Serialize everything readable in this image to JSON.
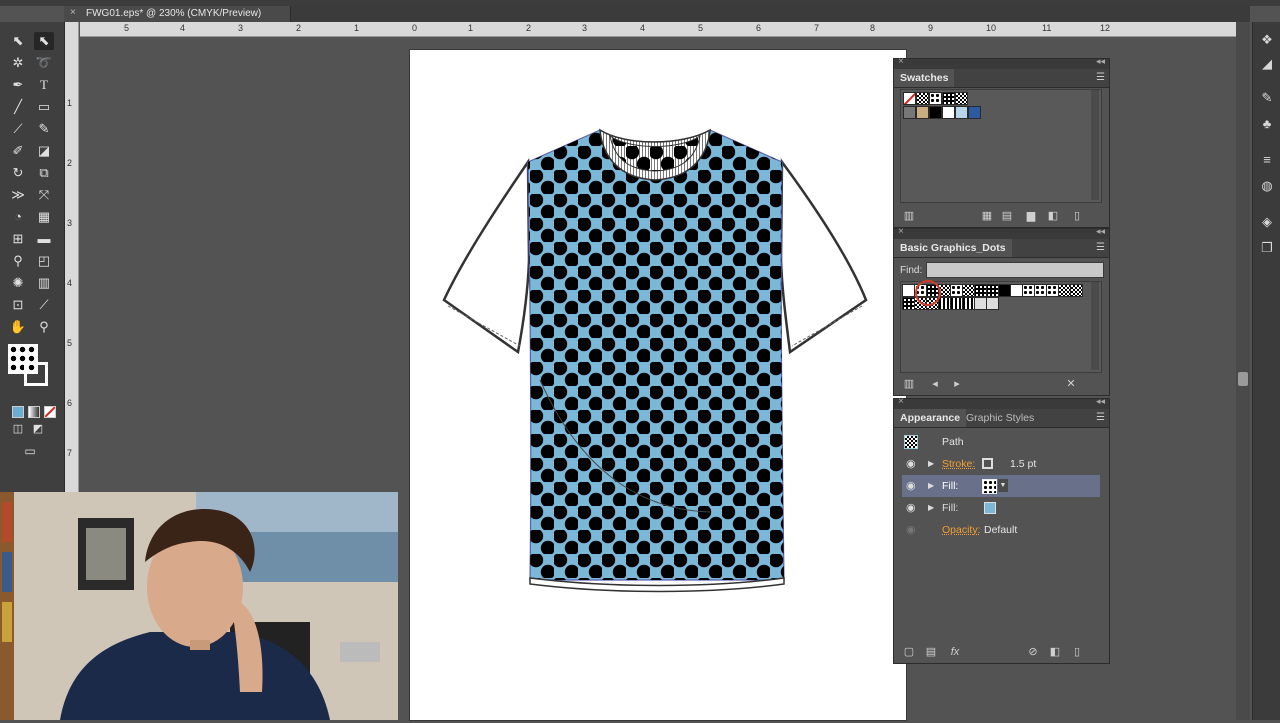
{
  "document": {
    "tab_title": "FWG01.eps* @ 230% (CMYK/Preview)",
    "close_glyph": "×"
  },
  "rulers": {
    "horizontal": [
      "5",
      "4",
      "3",
      "2",
      "1",
      "0",
      "1",
      "2",
      "3",
      "4",
      "5",
      "6",
      "7",
      "8",
      "9",
      "10",
      "11",
      "12"
    ],
    "vertical": [
      "1",
      "2",
      "3",
      "4",
      "5",
      "6",
      "7"
    ]
  },
  "tools": {
    "icons": [
      "selection-tool-icon",
      "direct-selection-tool-icon",
      "magic-wand-tool-icon",
      "lasso-tool-icon",
      "pen-tool-icon",
      "type-tool-icon",
      "line-tool-icon",
      "rectangle-tool-icon",
      "paintbrush-tool-icon",
      "pencil-tool-icon",
      "shaper-tool-icon",
      "eraser-tool-icon",
      "rotate-tool-icon",
      "scale-tool-icon",
      "width-tool-icon",
      "free-transform-tool-icon",
      "shape-builder-tool-icon",
      "perspective-grid-tool-icon",
      "mesh-tool-icon",
      "gradient-tool-icon",
      "eyedropper-tool-icon",
      "blend-tool-icon",
      "symbol-sprayer-tool-icon",
      "column-graph-tool-icon",
      "artboard-tool-icon",
      "slice-tool-icon",
      "hand-tool-icon",
      "zoom-tool-icon"
    ]
  },
  "swatches_panel": {
    "title": "Swatches",
    "colors": [
      "#ffffff",
      "#c8ad7f",
      "#000000",
      "#ffffff",
      "#b7d6e8",
      "#6aaed6",
      "#2b5aa0"
    ]
  },
  "library_panel": {
    "title": "Basic Graphics_Dots",
    "find_label": "Find:",
    "find_value": ""
  },
  "appearance_panel": {
    "tab_active": "Appearance",
    "tab_inactive": "Graphic Styles",
    "object_type": "Path",
    "rows": [
      {
        "label": "Stroke:",
        "value": "1.5 pt",
        "selected": false
      },
      {
        "label": "Fill:",
        "value": "",
        "selected": true
      },
      {
        "label": "Fill:",
        "value": "",
        "selected": false
      },
      {
        "label": "Opacity:",
        "value": "Default",
        "selected": false
      }
    ],
    "fill_color": "#7bb8d8"
  },
  "artwork": {
    "shirt_body_color": "#7bb8d8",
    "dot_color": "#000000",
    "sleeve_color": "#ffffff"
  }
}
